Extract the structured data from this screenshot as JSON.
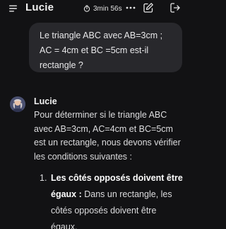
{
  "header": {
    "title": "Lucie",
    "timer": "3min 56s",
    "icons": {
      "menu": "hamburger-menu-icon",
      "timer": "stopwatch-icon",
      "more": "ellipsis-icon",
      "edit": "edit-icon",
      "logout": "logout-icon"
    }
  },
  "conversation": {
    "user_message": "Le triangle ABC avec AB=3cm ; AC = 4cm et BC =5cm est-il rectangle ?",
    "assistant": {
      "name": "Lucie",
      "intro": "Pour déterminer si le triangle ABC avec AB=3cm, AC=4cm et BC=5cm est un rectangle, nous devons vérifier les conditions suivantes :",
      "list": [
        {
          "number": "1.",
          "bold": "Les côtés opposés doivent être égaux :",
          "text": " Dans un rectangle, les côtés opposés doivent être égaux."
        }
      ]
    }
  },
  "colors": {
    "background": "#121214",
    "bubble": "#28282c",
    "text": "#dcdcde"
  }
}
